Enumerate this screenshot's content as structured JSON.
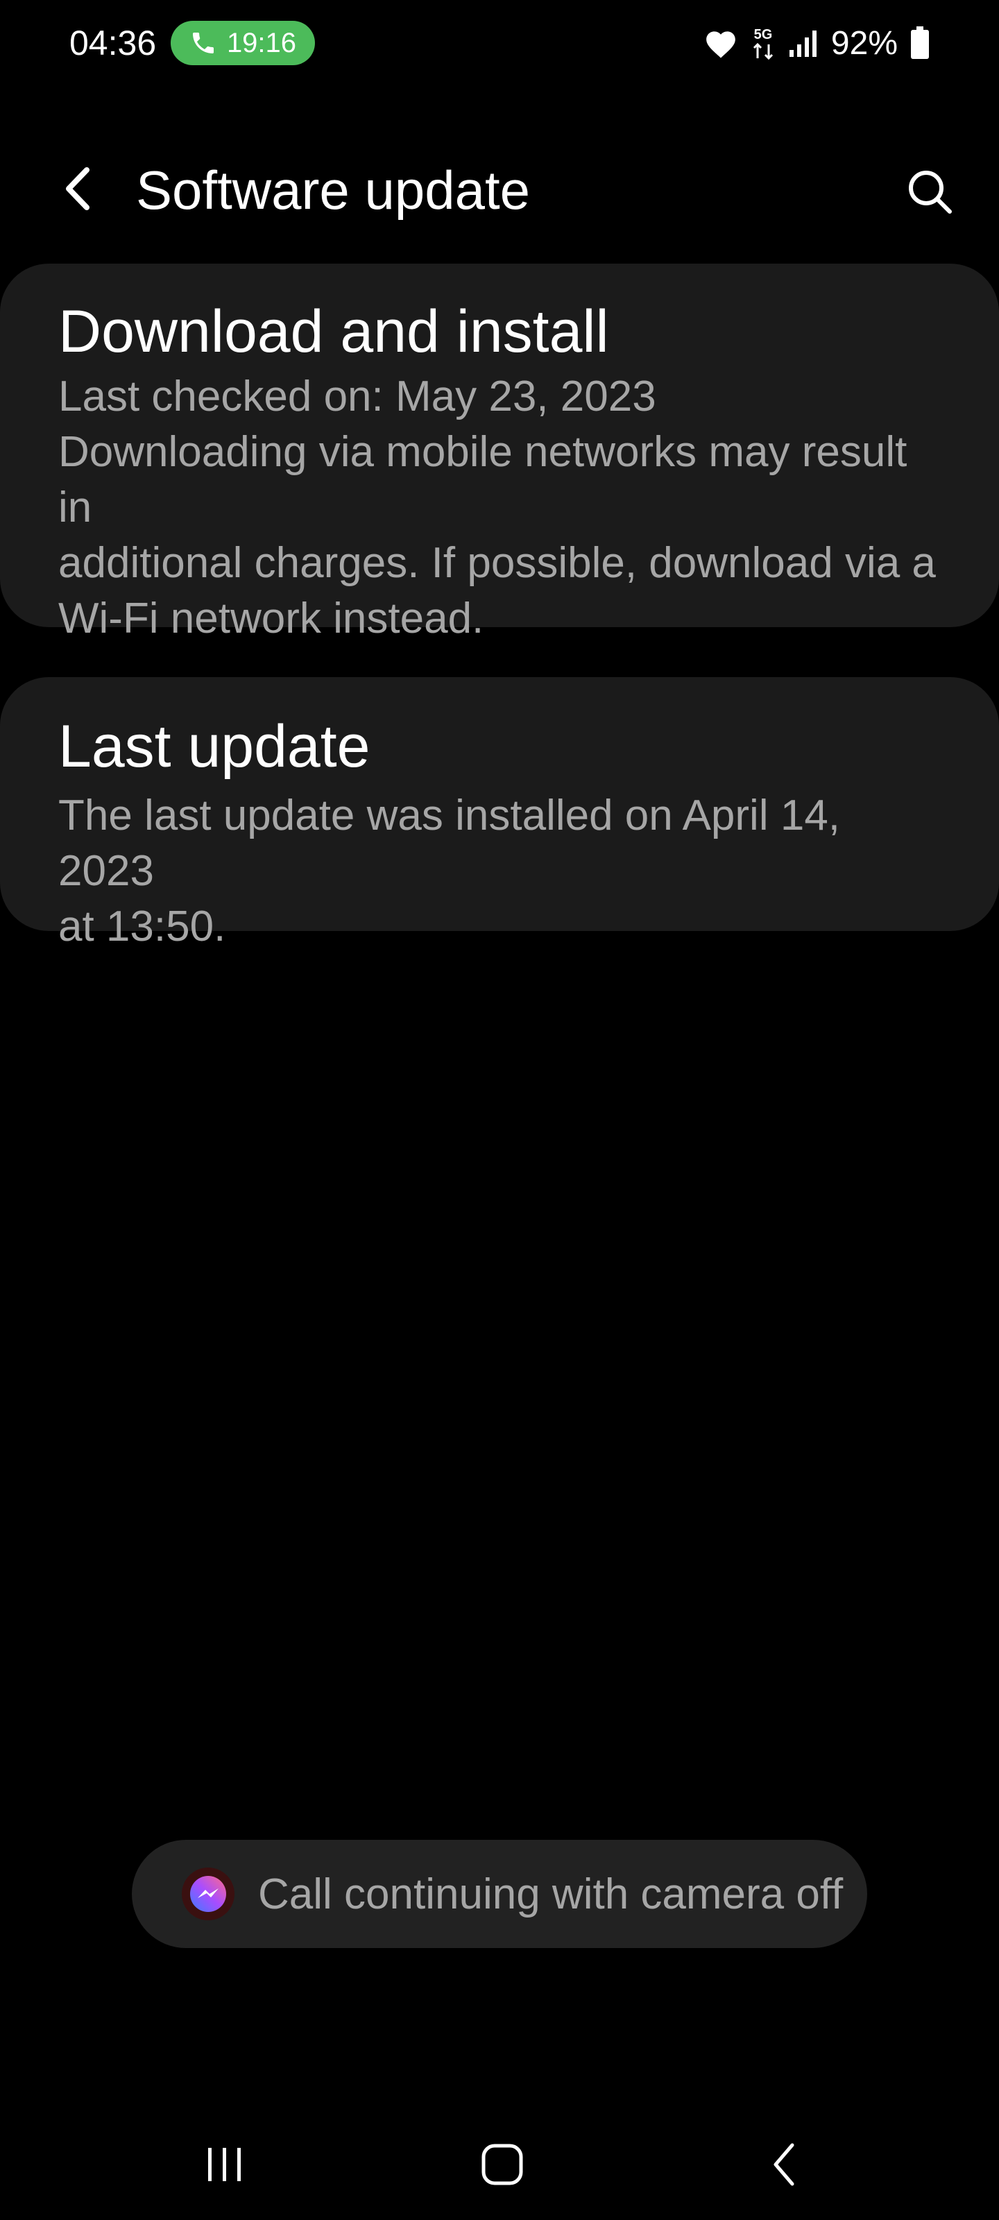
{
  "status_bar": {
    "time": "04:36",
    "call_duration": "19:16",
    "network_type": "5G",
    "battery_percent": "92%"
  },
  "header": {
    "title": "Software update"
  },
  "download_card": {
    "title": "Download and install",
    "last_checked": "Last checked on: May 23, 2023",
    "warning_line_1": "Downloading via mobile networks may result in",
    "warning_line_2": "additional charges. If possible, download via a",
    "warning_line_3": "Wi-Fi network instead."
  },
  "last_update_card": {
    "title": "Last update",
    "detail_line_1": "The last update was installed on April 14, 2023",
    "detail_line_2": "at 13:50."
  },
  "toast": {
    "message": "Call continuing with camera off"
  },
  "colors": {
    "background": "#000000",
    "card": "#1b1b1b",
    "secondary_text": "#a6a6a6",
    "call_pill": "#4cbb5a"
  },
  "icons": {
    "back": "back-arrow-icon",
    "search": "search-icon",
    "call": "phone-icon",
    "heart": "heart-icon",
    "signal": "signal-icon",
    "battery": "battery-icon",
    "messenger": "messenger-icon",
    "nav_recents": "recents-icon",
    "nav_home": "home-icon",
    "nav_back": "nav-back-icon"
  }
}
